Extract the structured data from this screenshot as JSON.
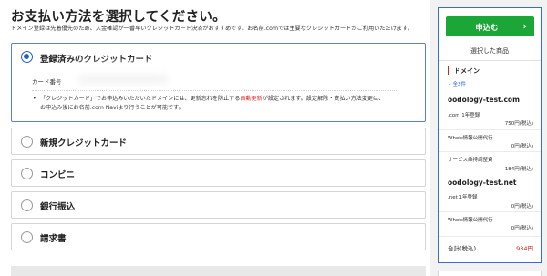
{
  "page": {
    "title": "お支払い方法を選択してください。",
    "description": "ドメイン登録は先着優先のため、入金確認が一番早いクレジットカード決済がおすすめです。お名前.comでは主要なクレジットカードがご利用いただけます。"
  },
  "payment_options": [
    {
      "label": "登録済みのクレジットカード",
      "selected": true
    },
    {
      "label": "新規クレジットカード",
      "selected": false
    },
    {
      "label": "コンビニ",
      "selected": false
    },
    {
      "label": "銀行振込",
      "selected": false
    },
    {
      "label": "請求書",
      "selected": false
    }
  ],
  "registered_card": {
    "card_number_label": "カード番号",
    "note_bullet": "•",
    "note_line1_pre": "「クレジットカード」でお申込みいただいたドメインには、更新忘れを防止する",
    "note_line1_red": "自動更新",
    "note_line1_post": "が設定されます。設定解除・支払い方法変更は、",
    "note_line2": "お申込み後にお名前.com Naviより行うことが可能です。"
  },
  "sidebar": {
    "apply_button": "申込む",
    "apply_arrow": "›",
    "selected_title": "選択した商品",
    "category": "ドメイン",
    "toggle_icon": "–",
    "toggle_label": "全2件",
    "domains": [
      {
        "name": "oodology-test.com",
        "items": [
          {
            "name": ".com 1年登録",
            "price": "750円(税込)"
          },
          {
            "name": "Whois情報公開代行",
            "price": "0円(税込)"
          },
          {
            "name": "サービス維持調整費",
            "price": "184円(税込)"
          }
        ]
      },
      {
        "name": "oodology-test.net",
        "items": [
          {
            "name": ".net 1年登録",
            "price": "0円(税込)"
          },
          {
            "name": "Whois情報公開代行",
            "price": "0円(税込)"
          }
        ]
      }
    ],
    "total_label": "合計(税込)",
    "total_price": "934円"
  },
  "colors": {
    "accent_blue": "#1f5fd8",
    "apply_green": "#1ca637",
    "alert_red": "#d8261c",
    "sidebar_border": "#2f6fd6"
  }
}
